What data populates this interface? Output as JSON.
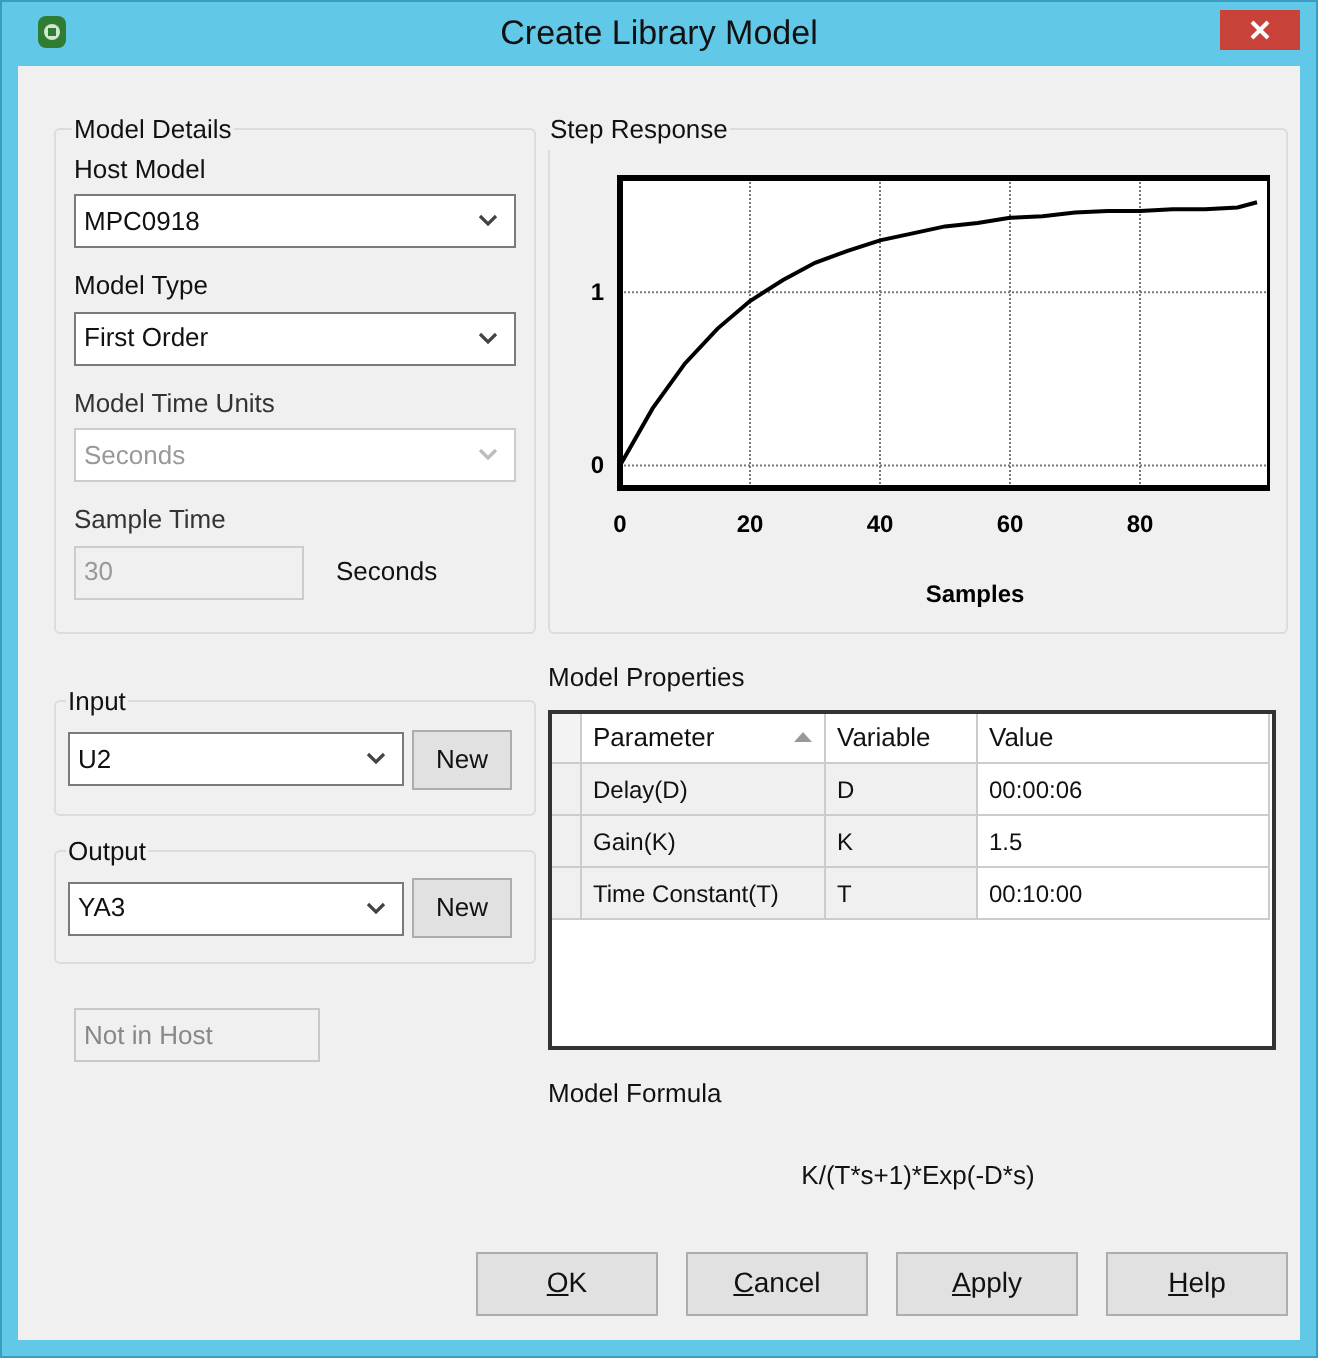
{
  "window": {
    "title": "Create Library Model"
  },
  "model_details": {
    "title": "Model Details",
    "fields": [
      {
        "label": "Host Model",
        "value": "MPC0918",
        "kind": "dropdown",
        "disabled": false
      },
      {
        "label": "Model Type",
        "value": "First Order",
        "kind": "dropdown",
        "disabled": false
      },
      {
        "label": "Model Time Units",
        "value": "Seconds",
        "kind": "dropdown",
        "disabled": true
      },
      {
        "label": "Sample Time",
        "value": "30",
        "kind": "text",
        "disabled": true,
        "unit": "Seconds"
      }
    ]
  },
  "input": {
    "title": "Input",
    "value": "U2",
    "button": "New"
  },
  "output": {
    "title": "Output",
    "value": "YA3",
    "button": "New"
  },
  "host_status": {
    "value": "Not in Host",
    "disabled": true
  },
  "step_response": {
    "title": "Step Response",
    "chart_data": {
      "type": "line",
      "xlabel": "Samples",
      "x": [
        0,
        5,
        10,
        15,
        20,
        25,
        30,
        35,
        40,
        45,
        50,
        55,
        60,
        65,
        70,
        75,
        80,
        85,
        90,
        95,
        98
      ],
      "series": [
        {
          "color": "#000000",
          "values": [
            0,
            0.33,
            0.59,
            0.79,
            0.95,
            1.07,
            1.17,
            1.24,
            1.3,
            1.34,
            1.38,
            1.4,
            1.43,
            1.44,
            1.46,
            1.47,
            1.47,
            1.48,
            1.48,
            1.49,
            1.52
          ]
        }
      ],
      "xlim": [
        0,
        100
      ],
      "ylim": [
        -0.13,
        1.66
      ],
      "xticks": [
        0,
        20,
        40,
        60,
        80
      ],
      "yticks": [
        0,
        1
      ],
      "grid": true
    }
  },
  "model_properties": {
    "title": "Model Properties",
    "columns": [
      {
        "label": "Parameter",
        "sorted": true
      },
      {
        "label": "Variable",
        "sorted": false
      },
      {
        "label": "Value",
        "sorted": false
      }
    ],
    "rows": [
      [
        "Delay(D)",
        "D",
        "00:00:06"
      ],
      [
        "Gain(K)",
        "K",
        "1.5"
      ],
      [
        "Time Constant(T)",
        "T",
        "00:10:00"
      ]
    ]
  },
  "model_formula": {
    "title": "Model Formula",
    "formula": "K/(T*s+1)*Exp(-D*s)"
  },
  "buttons": [
    {
      "label": "OK",
      "mnemonic": true
    },
    {
      "label": "Cancel",
      "mnemonic": true
    },
    {
      "label": "Apply",
      "mnemonic": true
    },
    {
      "label": "Help",
      "mnemonic": true
    }
  ]
}
